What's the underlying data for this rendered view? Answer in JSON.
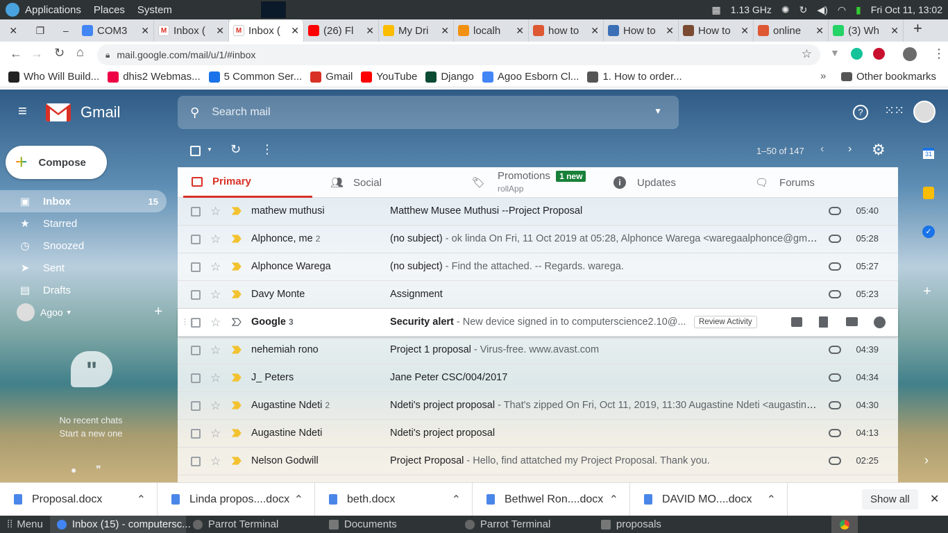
{
  "system": {
    "menus": [
      "Applications",
      "Places",
      "System"
    ],
    "cpu": "1.13 GHz",
    "datetime": "Fri Oct 11, 13:02"
  },
  "browser": {
    "tabs": [
      {
        "label": "COM3",
        "icon": "docs-icon",
        "color": "#4285f4"
      },
      {
        "label": "Inbox (",
        "icon": "gmail-icon",
        "color": "#ffffff"
      },
      {
        "label": "Inbox (",
        "icon": "gmail-icon",
        "color": "#ffffff"
      },
      {
        "label": "(26) Fl",
        "icon": "youtube-icon",
        "color": "#ff0000"
      },
      {
        "label": "My Dri",
        "icon": "drive-icon",
        "color": "#fbbc04"
      },
      {
        "label": "localh",
        "icon": "phpmyadmin-icon",
        "color": "#f29111"
      },
      {
        "label": "how to",
        "icon": "duckduckgo-icon",
        "color": "#de5833"
      },
      {
        "label": "How to",
        "icon": "page-icon",
        "color": "#3b6fb6"
      },
      {
        "label": "How to",
        "icon": "avatar-icon",
        "color": "#7a4a33"
      },
      {
        "label": "online",
        "icon": "duckduckgo-icon",
        "color": "#de5833"
      },
      {
        "label": "(3) Wh",
        "icon": "whatsapp-icon",
        "color": "#25d366"
      }
    ],
    "url": "mail.google.com/mail/u/1/#inbox",
    "bookmarks": [
      {
        "label": "Who Will Build...",
        "color": "#222"
      },
      {
        "label": "dhis2 Webmas...",
        "color": "#e04"
      },
      {
        "label": "5 Common Ser...",
        "color": "#1a73e8"
      },
      {
        "label": "Gmail",
        "color": "#d93025"
      },
      {
        "label": "YouTube",
        "color": "#ff0000"
      },
      {
        "label": "Django",
        "color": "#0c4b33"
      },
      {
        "label": "Agoo Esborn Cl...",
        "color": "#4285f4"
      },
      {
        "label": "1. How to order...",
        "color": "#555"
      }
    ],
    "other_bookmarks": "Other bookmarks"
  },
  "gmail": {
    "logo": "Gmail",
    "search_placeholder": "Search mail",
    "compose": "Compose",
    "nav": [
      {
        "label": "Inbox",
        "count": "15",
        "icon": "inbox-icon"
      },
      {
        "label": "Starred",
        "count": "",
        "icon": "star-icon"
      },
      {
        "label": "Snoozed",
        "count": "",
        "icon": "clock-icon"
      },
      {
        "label": "Sent",
        "count": "",
        "icon": "send-icon"
      },
      {
        "label": "Drafts",
        "count": "",
        "icon": "draft-icon"
      }
    ],
    "account": "Agoo",
    "hangouts": {
      "line1": "No recent chats",
      "line2": "Start a new one"
    },
    "pagination": "1–50 of 147",
    "categories": [
      {
        "label": "Primary",
        "sub": "",
        "badge": ""
      },
      {
        "label": "Social",
        "sub": "",
        "badge": ""
      },
      {
        "label": "Promotions",
        "sub": "rollApp",
        "badge": "1 new"
      },
      {
        "label": "Updates",
        "sub": "",
        "badge": ""
      },
      {
        "label": "Forums",
        "sub": "",
        "badge": ""
      }
    ],
    "emails": [
      {
        "sender": "mathew muthusi",
        "n": "",
        "subject": "Matthew Musee Muthusi --Project Proposal",
        "snippet": "",
        "time": "05:40"
      },
      {
        "sender": "Alphonce, me",
        "n": "2",
        "subject": "(no subject)",
        "snippet": " - ok linda On Fri, 11 Oct 2019 at 05:28, Alphonce Warega <waregaalphonce@gmail....",
        "time": "05:28"
      },
      {
        "sender": "Alphonce Warega",
        "n": "",
        "subject": "(no subject)",
        "snippet": " - Find the attached. -- Regards. warega.",
        "time": "05:27"
      },
      {
        "sender": "Davy Monte",
        "n": "",
        "subject": "Assignment",
        "snippet": "",
        "time": "05:23"
      },
      {
        "sender": "Google",
        "n": "3",
        "subject": "Security alert",
        "snippet": " - New device signed in to computerscience2.10@...",
        "time": ""
      },
      {
        "sender": "nehemiah rono",
        "n": "",
        "subject": "Project 1 proposal",
        "snippet": " - Virus-free. www.avast.com",
        "time": "04:39"
      },
      {
        "sender": "J_ Peters",
        "n": "",
        "subject": "Jane Peter CSC/004/2017",
        "snippet": "",
        "time": "04:34"
      },
      {
        "sender": "Augastine Ndeti",
        "n": "2",
        "subject": "Ndeti's project proposal",
        "snippet": " - That's zipped On Fri, Oct 11, 2019, 11:30 Augastine Ndeti <augastinen...",
        "time": "04:30"
      },
      {
        "sender": "Augastine Ndeti",
        "n": "",
        "subject": "Ndeti's project proposal",
        "snippet": "",
        "time": "04:13"
      },
      {
        "sender": "Nelson Godwill",
        "n": "",
        "subject": "Project Proposal",
        "snippet": " - Hello, find attatched my Project Proposal. Thank you.",
        "time": "02:25"
      }
    ],
    "review_activity": "Review Activity"
  },
  "downloads": {
    "files": [
      "Proposal.docx",
      "Linda propos....docx",
      "beth.docx",
      "Bethwel Ron....docx",
      "DAVID MO....docx"
    ],
    "show_all": "Show all"
  },
  "taskbar": {
    "menu": "Menu",
    "items": [
      {
        "label": "Inbox (15) - computersc...",
        "color": "#4285f4"
      },
      {
        "label": "Parrot Terminal",
        "color": "#666"
      },
      {
        "label": "Documents",
        "color": "#777"
      },
      {
        "label": "Parrot Terminal",
        "color": "#666"
      },
      {
        "label": "proposals",
        "color": "#777"
      }
    ]
  }
}
